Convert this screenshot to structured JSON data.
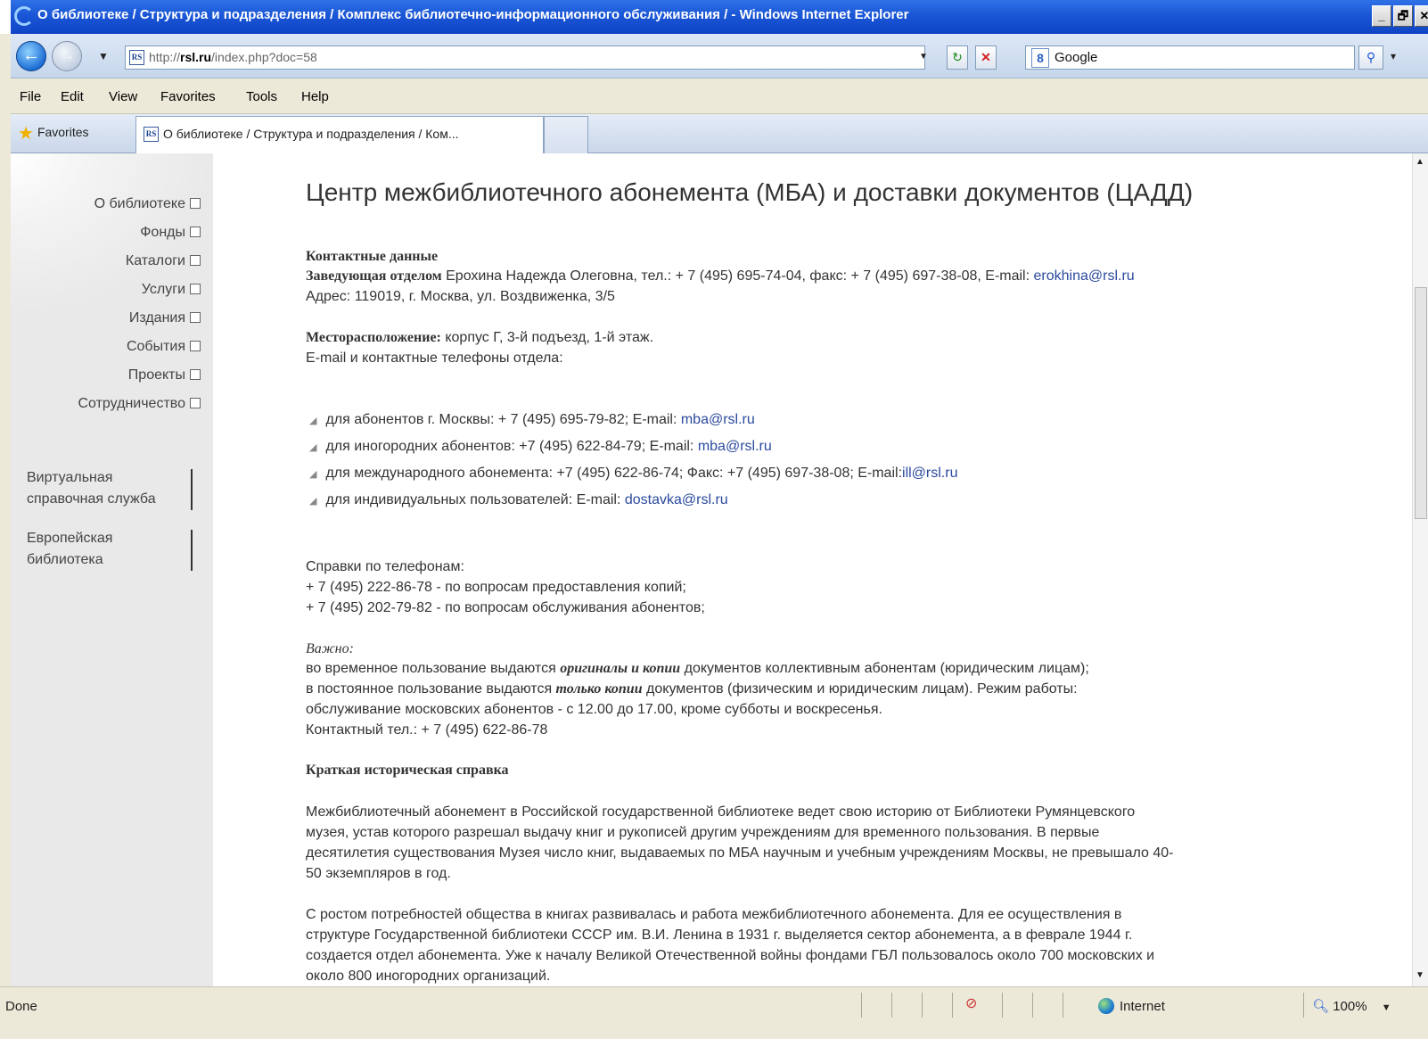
{
  "window": {
    "title": "О библиотеке / Структура и подразделения / Комплекс библиотечно-информационного обслуживания /  - Windows Internet Explorer",
    "buttons": [
      "_",
      "🗗",
      "✕"
    ]
  },
  "addressbar": {
    "url_prefix": "http://",
    "url_domain": "rsl.ru",
    "url_path": "/index.php?doc=58",
    "search_engine": "Google",
    "search_logo": "8"
  },
  "menu": [
    "File",
    "Edit",
    "View",
    "Favorites",
    "Tools",
    "Help"
  ],
  "favbar": {
    "favorites_label": "Favorites",
    "tab_title": "О библиотеке / Структура и подразделения / Ком..."
  },
  "sidebar": {
    "items": [
      {
        "label": "О библиотеке"
      },
      {
        "label": "Фонды"
      },
      {
        "label": "Каталоги"
      },
      {
        "label": "Услуги"
      },
      {
        "label": "Издания"
      },
      {
        "label": "События"
      },
      {
        "label": "Проекты"
      },
      {
        "label": "Сотрудничество"
      }
    ],
    "blocks": [
      {
        "line1": "Виртуальная",
        "line2": "справочная служба"
      },
      {
        "line1": "Европейская",
        "line2": "библиотека"
      }
    ]
  },
  "main": {
    "heading": "Центр межбиблиотечного абонемента (МБА) и доставки документов (ЦАДД)",
    "contact_title": "Контактные данные",
    "head_label": "Заведующая отделом",
    "head_text": " Ерохина Надежда Олеговна, тел.: + 7 (495) 695-74-04, факс: + 7 (495) 697-38-08, E-mail: ",
    "head_email": "erokhina@rsl.ru",
    "address": "Адрес: 119019, г. Москва, ул. Воздвиженка, 3/5",
    "location_label": "Месторасположение:",
    "location_text": " корпус Г, 3-й подъезд, 1-й этаж.",
    "email_intro": "E-mail и контактные телефоны отдела:",
    "bullets": [
      {
        "text": "для абонентов г. Москвы: + 7 (495) 695-79-82; E-mail: ",
        "email": "mba@rsl.ru"
      },
      {
        "text": "для иногородних абонентов: +7 (495) 622-84-79; E-mail: ",
        "email": "mba@rsl.ru"
      },
      {
        "text": "для международного абонемента: +7 (495) 622-86-74; Факс: +7 (495) 697-38-08; E-mail:",
        "email": "ill@rsl.ru"
      },
      {
        "text": "для индивидуальных пользователей: E-mail: ",
        "email": "dostavka@rsl.ru"
      }
    ],
    "phones_title": "Справки по телефонам:",
    "phone1": "+ 7 (495) 222-86-78 - по вопросам предоставления копий;",
    "phone2": "+ 7 (495) 202-79-82 - по вопросам обслуживания абонентов;",
    "important_label": "Важно:",
    "imp1_a": "во временное пользование выдаются ",
    "imp1_b": "оригиналы и копии",
    "imp1_c": " документов коллективным абонентам (юридическим лицам);",
    "imp2_a": "в постоянное пользование выдаются ",
    "imp2_b": "только копии",
    "imp2_c": " документов (физическим и юридическим лицам). Режим работы:",
    "imp3": "обслуживание московских абонентов - с 12.00 до 17.00, кроме субботы и воскресенья.",
    "imp4": "Контактный тел.: + 7 (495) 622-86-78",
    "history_title": "Краткая историческая справка",
    "p1": [
      "Межбиблиотечный абонемент в Российской государственной библиотеке ведет свою историю от Библиотеки Румянцевского",
      "музея, устав которого разрешал выдачу книг и рукописей другим учреждениям для временного пользования. В первые",
      "десятилетия существования Музея число книг, выдаваемых по МБА научным и учебным учреждениям Москвы, не превышало 40-",
      "50 экземпляров в год."
    ],
    "p2": [
      "С ростом потребностей общества в книгах развивалась и работа межбиблиотечного абонемента. Для ее осуществления в",
      "структуре Государственной библиотеки СССР им. В.И. Ленина в 1931 г. выделяется сектор абонемента, а в феврале 1944 г.",
      "создается отдел абонемента. Уже к началу Великой Отечественной войны фондами ГБЛ пользовалось около 700 московских и",
      "около 800 иногородних организаций."
    ]
  },
  "status": {
    "text": "Done",
    "zone": "Internet",
    "zoom": "100%"
  },
  "icons": {
    "back": "back-arrow-icon",
    "forward": "forward-arrow-icon",
    "refresh": "refresh-icon",
    "stop": "stop-icon",
    "search": "search-icon",
    "star": "favorites-star-icon",
    "globe": "internet-globe-icon"
  },
  "colors": {
    "titlebar": "#1a56d6",
    "link": "#2b4a9e",
    "sidebar": "#e9e9e9"
  }
}
